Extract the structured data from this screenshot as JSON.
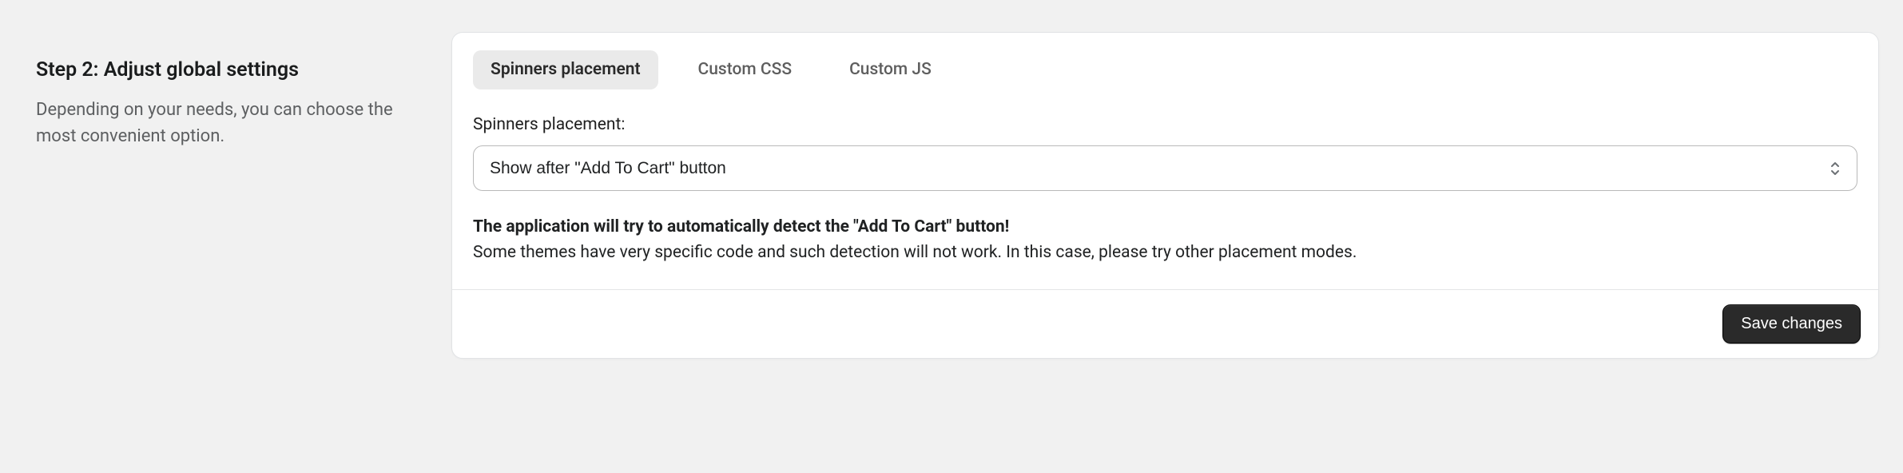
{
  "left": {
    "title": "Step 2: Adjust global settings",
    "description": "Depending on your needs, you can choose the most convenient option."
  },
  "tabs": {
    "items": [
      {
        "label": "Spinners placement",
        "active": true
      },
      {
        "label": "Custom CSS",
        "active": false
      },
      {
        "label": "Custom JS",
        "active": false
      }
    ]
  },
  "field": {
    "label": "Spinners placement:",
    "value": "Show after \"Add To Cart\" button"
  },
  "note": {
    "strong": "The application will try to automatically detect the \"Add To Cart\" button!",
    "rest": "Some themes have very specific code and such detection will not work. In this case, please try other placement modes."
  },
  "footer": {
    "save_label": "Save changes"
  }
}
